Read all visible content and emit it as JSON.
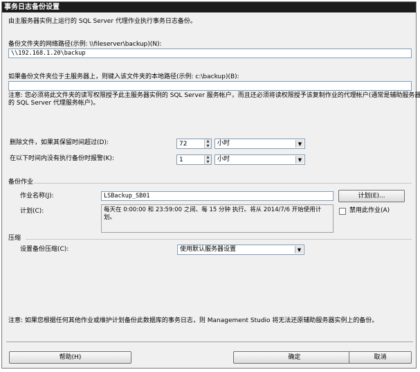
{
  "window": {
    "title": "事务日志备份设置"
  },
  "intro": "由主服务器实例上运行的 SQL Server 代理作业执行事务日志备份。",
  "network_path": {
    "label": "备份文件夹的网络路径(示例: \\\\fileserver\\backup)(N):",
    "value": "\\\\192.168.1.20\\backup"
  },
  "local_path": {
    "label": "如果备份文件夹位于主服务器上，则键入该文件夹的本地路径(示例: c:\\backup)(B):",
    "value": ""
  },
  "note1": {
    "line1": "注意: 您必须将此文件夹的读写权限授予此主服务器实例的 SQL Server 服务帐户，而且还必须将读权限授予该复制作业的代理帐户(通常是辅助服务器实例上",
    "line2": "的 SQL Server 代理服务帐户)。"
  },
  "delete_files": {
    "label": "删除文件，如果其保留时间超过(D):",
    "value": "72",
    "unit": "小时"
  },
  "alert": {
    "label": "在以下时间内没有执行备份时报警(K):",
    "value": "1",
    "unit": "小时"
  },
  "backup_job": {
    "section_title": "备份作业",
    "name_label": "作业名称(J):",
    "name_value": "LSBackup_SB01",
    "schedule_button": "计划(E)...",
    "schedule_label": "计划(C):",
    "schedule_text": "每天在 0:00:00 和 23:59:00 之间、每 15 分钟 执行。将从 2014/7/6 开始使用计划。",
    "disable_label": "禁用此作业(A)",
    "disable_checked": false
  },
  "compression": {
    "section_title": "压缩",
    "label": "设置备份压缩(C):",
    "value": "使用默认服务器设置"
  },
  "note2": "注意: 如果您根据任何其他作业或维护计划备份此数据库的事务日志，则 Management Studio 将无法还原辅助服务器实例上的备份。",
  "buttons": {
    "help": "帮助(H)",
    "ok": "确定",
    "cancel": "取消"
  },
  "icons": {
    "spin": "spin-arrows-icon",
    "dropdown": "dropdown-arrow-icon"
  }
}
